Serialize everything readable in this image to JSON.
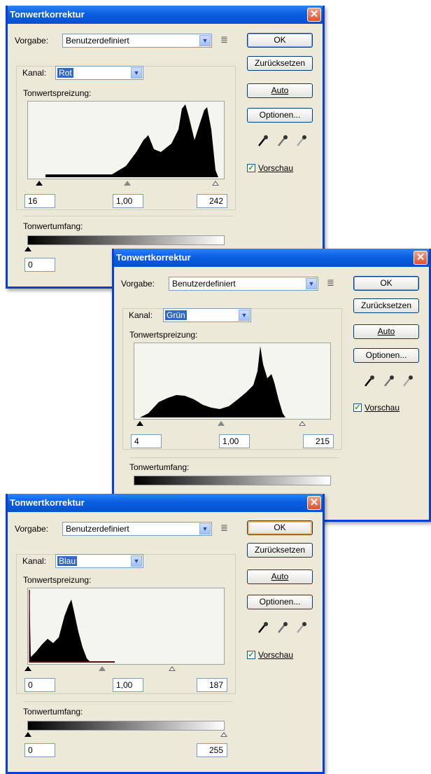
{
  "dialogs": [
    {
      "title": "Tonwertkorrektur",
      "preset_label": "Vorgabe:",
      "preset_value": "Benutzerdefiniert",
      "channel_label": "Kanal:",
      "channel_value": "Rot",
      "input_levels_label": "Tonwertspreizung:",
      "input_black": "16",
      "input_gamma": "1,00",
      "input_white": "242",
      "output_levels_label": "Tonwertumfang:",
      "output_black": "0",
      "output_white": "",
      "histogram_color": "#000000"
    },
    {
      "title": "Tonwertkorrektur",
      "preset_label": "Vorgabe:",
      "preset_value": "Benutzerdefiniert",
      "channel_label": "Kanal:",
      "channel_value": "Grün",
      "input_levels_label": "Tonwertspreizung:",
      "input_black": "4",
      "input_gamma": "1,00",
      "input_white": "215",
      "output_levels_label": "Tonwertumfang:",
      "output_black": "",
      "output_white": "",
      "histogram_color": "#000000"
    },
    {
      "title": "Tonwertkorrektur",
      "preset_label": "Vorgabe:",
      "preset_value": "Benutzerdefiniert",
      "channel_label": "Kanal:",
      "channel_value": "Blau",
      "input_levels_label": "Tonwertspreizung:",
      "input_black": "0",
      "input_gamma": "1,00",
      "input_white": "187",
      "output_levels_label": "Tonwertumfang:",
      "output_black": "0",
      "output_white": "255",
      "histogram_color": "#000000"
    }
  ],
  "buttons": {
    "ok": "OK",
    "reset": "Zurücksetzen",
    "auto": "Auto",
    "options": "Optionen...",
    "preview": "Vorschau",
    "close": "✕"
  },
  "icons": {
    "eyedropper": "eyedropper-icon",
    "menu": "preset-menu-icon",
    "dropdown": "chevron-down-icon"
  },
  "colors": {
    "titlebar": "#0a5fe0",
    "face": "#ece9d8",
    "selection": "#316ac5",
    "close": "#e0502f"
  }
}
